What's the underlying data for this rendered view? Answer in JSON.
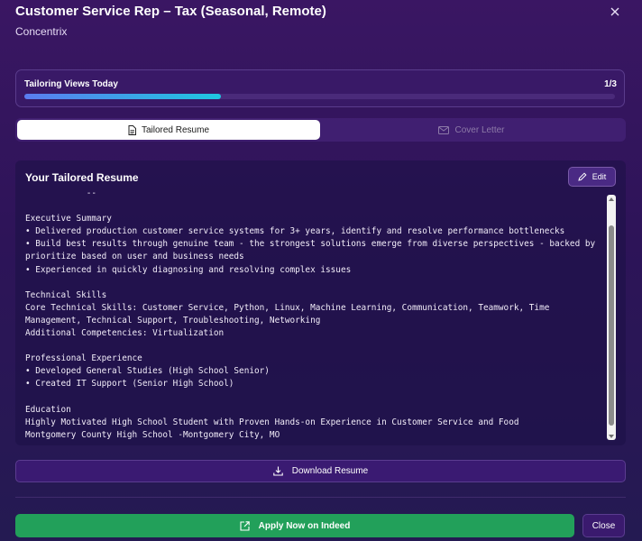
{
  "header": {
    "title": "Customer Service Rep – Tax (Seasonal, Remote)",
    "company": "Concentrix"
  },
  "usage": {
    "label": "Tailoring Views Today",
    "count_text": "1/3",
    "used": 1,
    "limit": 3
  },
  "tabs": [
    {
      "label": "Tailored Resume",
      "active": true,
      "icon": "document-icon"
    },
    {
      "label": "Cover Letter",
      "active": false,
      "icon": "mail-icon"
    }
  ],
  "resume": {
    "heading": "Your Tailored Resume",
    "edit_label": "Edit",
    "text": "            --\n\nExecutive Summary\n• Delivered production customer service systems for 3+ years, identify and resolve performance bottlenecks\n• Build best results through genuine team - the strongest solutions emerge from diverse perspectives - backed by prioritize based on user and business needs\n• Experienced in quickly diagnosing and resolving complex issues\n\nTechnical Skills\nCore Technical Skills: Customer Service, Python, Linux, Machine Learning, Communication, Teamwork, Time Management, Technical Support, Troubleshooting, Networking\nAdditional Competencies: Virtualization\n\nProfessional Experience\n• Developed General Studies (High School Senior)\n• Created IT Support (Senior High School)\n\nEducation\nHighly Motivated High School Student with Proven Hands-on Experience in Customer Service and Food\nMontgomery County High School -Montgomery City, MO"
  },
  "actions": {
    "download_label": "Download Resume",
    "apply_label": "Apply Now on Indeed",
    "close_label": "Close"
  },
  "colors": {
    "accent_green": "#22a05a",
    "progress_start": "#5b7cf0",
    "progress_end": "#1ec7e0",
    "card_border": "#5a3c8c"
  }
}
